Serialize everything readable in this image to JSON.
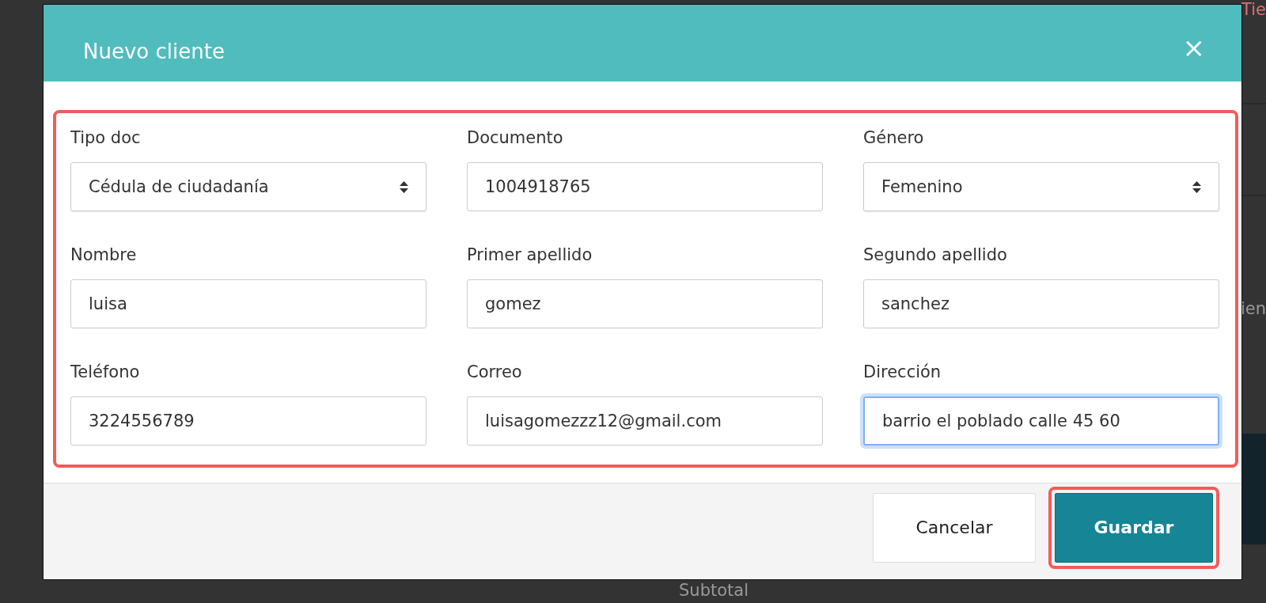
{
  "background": {
    "texts": [
      {
        "text": "Tie",
        "kind": "corner"
      },
      {
        "text": "ien",
        "kind": "edge"
      },
      {
        "text": "Subtotal",
        "kind": "bottom"
      }
    ]
  },
  "modal": {
    "title": "Nuevo cliente",
    "close_icon": "×",
    "fields": [
      {
        "label": "Tipo doc",
        "kind": "select",
        "value": "Cédula de ciudadanía",
        "focused": false
      },
      {
        "label": "Documento",
        "kind": "input",
        "value": "1004918765",
        "focused": false
      },
      {
        "label": "Género",
        "kind": "select",
        "value": "Femenino",
        "focused": false
      },
      {
        "label": "Nombre",
        "kind": "input",
        "value": "luisa",
        "focused": false
      },
      {
        "label": "Primer apellido",
        "kind": "input",
        "value": "gomez",
        "focused": false
      },
      {
        "label": "Segundo apellido",
        "kind": "input",
        "value": "sanchez",
        "focused": false
      },
      {
        "label": "Teléfono",
        "kind": "input",
        "value": "3224556789",
        "focused": false
      },
      {
        "label": "Correo",
        "kind": "input",
        "value": "luisagomezzz12@gmail.com",
        "focused": false
      },
      {
        "label": "Dirección",
        "kind": "input",
        "value": "barrio el poblado calle 45 60",
        "focused": true
      }
    ],
    "buttons": [
      {
        "label": "Cancelar",
        "kind": "secondary",
        "highlighted": false
      },
      {
        "label": "Guardar",
        "kind": "primary",
        "highlighted": true
      }
    ]
  }
}
